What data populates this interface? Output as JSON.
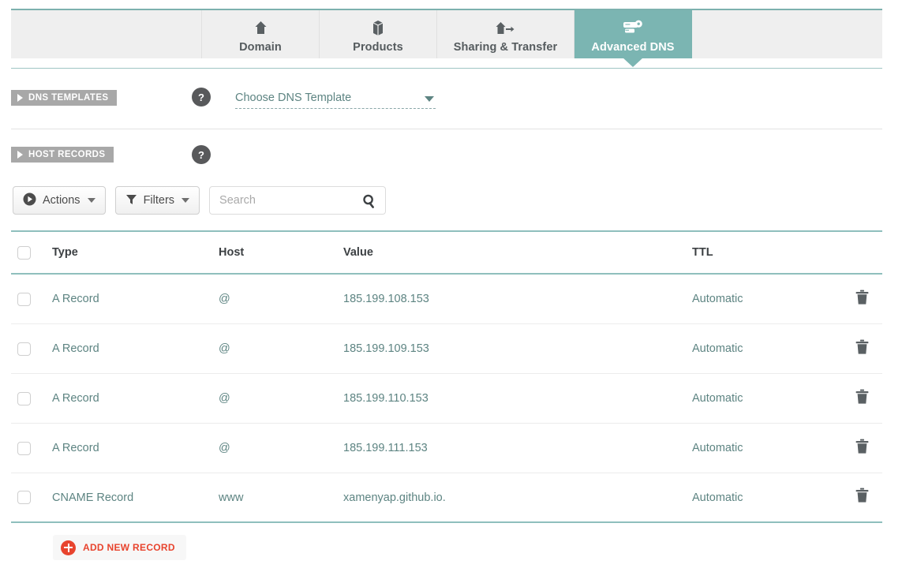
{
  "tabs": [
    {
      "label": "Domain",
      "icon": "home-icon",
      "active": false
    },
    {
      "label": "Products",
      "icon": "box-icon",
      "active": false
    },
    {
      "label": "Sharing & Transfer",
      "icon": "house-transfer-icon",
      "active": false
    },
    {
      "label": "Advanced DNS",
      "icon": "server-gear-icon",
      "active": true
    }
  ],
  "sections": {
    "dns_templates": {
      "badge_label": "DNS TEMPLATES",
      "help_label": "?",
      "select_value": "Choose DNS Template"
    },
    "host_records": {
      "badge_label": "HOST RECORDS",
      "help_label": "?"
    }
  },
  "toolbar": {
    "actions_label": "Actions",
    "filters_label": "Filters",
    "search_placeholder": "Search",
    "search_value": ""
  },
  "table": {
    "columns": [
      "Type",
      "Host",
      "Value",
      "TTL"
    ],
    "rows": [
      {
        "type": "A Record",
        "host": "@",
        "value": "185.199.108.153",
        "ttl": "Automatic"
      },
      {
        "type": "A Record",
        "host": "@",
        "value": "185.199.109.153",
        "ttl": "Automatic"
      },
      {
        "type": "A Record",
        "host": "@",
        "value": "185.199.110.153",
        "ttl": "Automatic"
      },
      {
        "type": "A Record",
        "host": "@",
        "value": "185.199.111.153",
        "ttl": "Automatic"
      },
      {
        "type": "CNAME Record",
        "host": "www",
        "value": "xamenyap.github.io.",
        "ttl": "Automatic"
      }
    ]
  },
  "add_record": {
    "label": "ADD NEW RECORD"
  },
  "colors": {
    "accent_teal": "#7bb5b2",
    "table_border_teal": "#8fbfbd",
    "link_teal": "#5d8482",
    "badge_gray": "#a8a8a8",
    "help_dark": "#58595b",
    "add_red": "#e8442e",
    "tab_bg": "#efefef"
  }
}
